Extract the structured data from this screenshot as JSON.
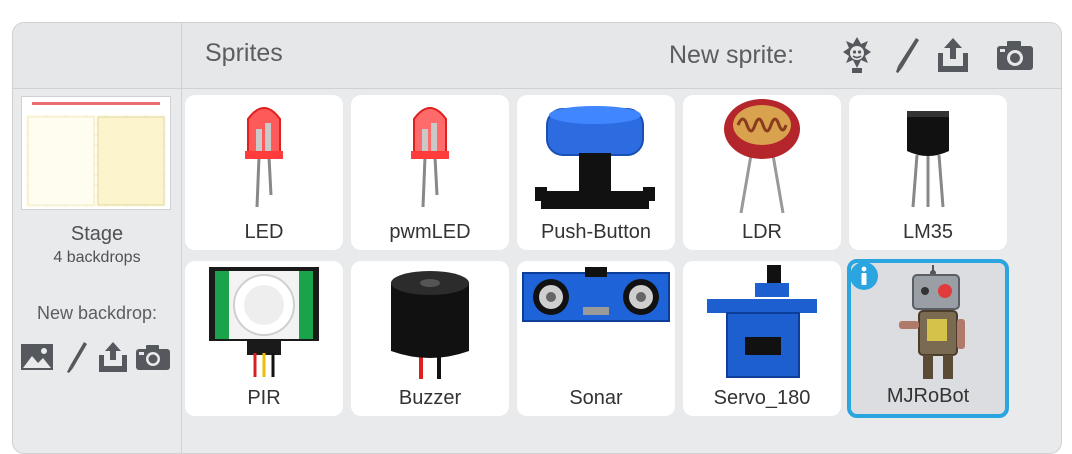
{
  "header": {
    "title": "Sprites",
    "new_sprite_label": "New sprite:"
  },
  "stage": {
    "label": "Stage",
    "backdrops": "4 backdrops",
    "new_backdrop_label": "New backdrop:"
  },
  "tools": {
    "sprite": [
      "sprite-library-icon",
      "paint-brush-icon",
      "upload-icon",
      "camera-icon"
    ],
    "backdrop": [
      "image-library-icon",
      "paint-brush-icon",
      "upload-icon",
      "camera-icon"
    ]
  },
  "sprites": [
    {
      "name": "LED"
    },
    {
      "name": "pwmLED"
    },
    {
      "name": "Push-Button"
    },
    {
      "name": "LDR"
    },
    {
      "name": "LM35"
    },
    {
      "name": "PIR"
    },
    {
      "name": "Buzzer"
    },
    {
      "name": "Sonar"
    },
    {
      "name": "Servo_180"
    },
    {
      "name": "MJRoBot",
      "selected": true
    }
  ],
  "colors": {
    "selection": "#2aa5df",
    "panel": "#e9eaeb",
    "tile": "#ffffff"
  }
}
